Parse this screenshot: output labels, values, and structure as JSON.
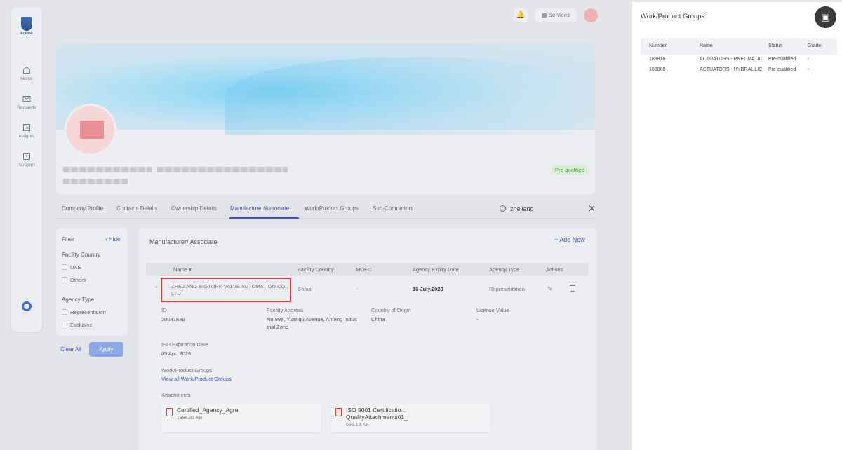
{
  "nav": {
    "logo_text": "ADNOC",
    "items": [
      {
        "label": "Home",
        "icon": "home-icon"
      },
      {
        "label": "Requests",
        "icon": "mail-icon"
      },
      {
        "label": "Insights",
        "icon": "chart-icon"
      },
      {
        "label": "Support",
        "icon": "support-icon"
      }
    ]
  },
  "topbar": {
    "services_label": "Services"
  },
  "profile": {
    "status_badge": "Pre-qualified"
  },
  "tabs": [
    "Company Profile",
    "Contacts Details",
    "Ownership Details",
    "Manufacturer/Associate",
    "Work/Product Groups",
    "Sub-Contractors"
  ],
  "search": {
    "value": "zhejiang"
  },
  "filter": {
    "title": "Filter",
    "hide_label": "Hide",
    "facility_country_heading": "Facility Country",
    "country_options": [
      "UAE",
      "Others"
    ],
    "agency_type_heading": "Agency Type",
    "agency_options": [
      "Representation",
      "Exclusive"
    ],
    "clear_all_label": "Clear All",
    "apply_label": "Apply"
  },
  "main": {
    "title": "Manufacturer/ Associate",
    "add_new_label": "Add New",
    "columns": [
      "Name",
      "Facility Country",
      "MOEC",
      "Agency Expiry Date",
      "Agency Type",
      "Actions"
    ],
    "row": {
      "name": "ZHEJIANG BIGTORK VALVE AUTOMATION CO., LTD",
      "country": "China",
      "moec": "-",
      "expiry": "16 July.2028",
      "agency_type": "Representation"
    },
    "details": {
      "id_label": "ID",
      "id_value": "20037836",
      "address_label": "Facility Address",
      "address_value": "No.998, Yuanqu Avenue, Anfeng Indus trial Zone",
      "origin_label": "Country of Origin",
      "origin_value": "China",
      "license_label": "License Value",
      "license_value": "-",
      "iso_label": "ISO Expiration Date",
      "iso_value": "05 Apr. 2028",
      "wpg_label": "Work/Product Groups",
      "wpg_link": "View all Work/Product Groups",
      "attachments_label": "Attachments"
    },
    "attachments": [
      {
        "name": "Certified_Agency_Agre",
        "size": "1986.31 KB"
      },
      {
        "name": "ISO 9001 Certificatio... QualityAttachments01_",
        "size": "695.19 KB"
      }
    ]
  },
  "panel": {
    "title": "Work/Product Groups",
    "columns": [
      "Number",
      "Name",
      "Status",
      "Grade"
    ],
    "rows": [
      {
        "number": "188816",
        "name": "ACTUATORS - PNEUMATIC",
        "status": "Pre-qualified",
        "grade": "-"
      },
      {
        "number": "188808",
        "name": "ACTUATORS - HYDRAULIC",
        "status": "Pre-qualified",
        "grade": "-"
      }
    ]
  },
  "colors": {
    "accent": "#3a56b8",
    "highlight": "#e0393e",
    "badge_green": "#4a9b45"
  }
}
